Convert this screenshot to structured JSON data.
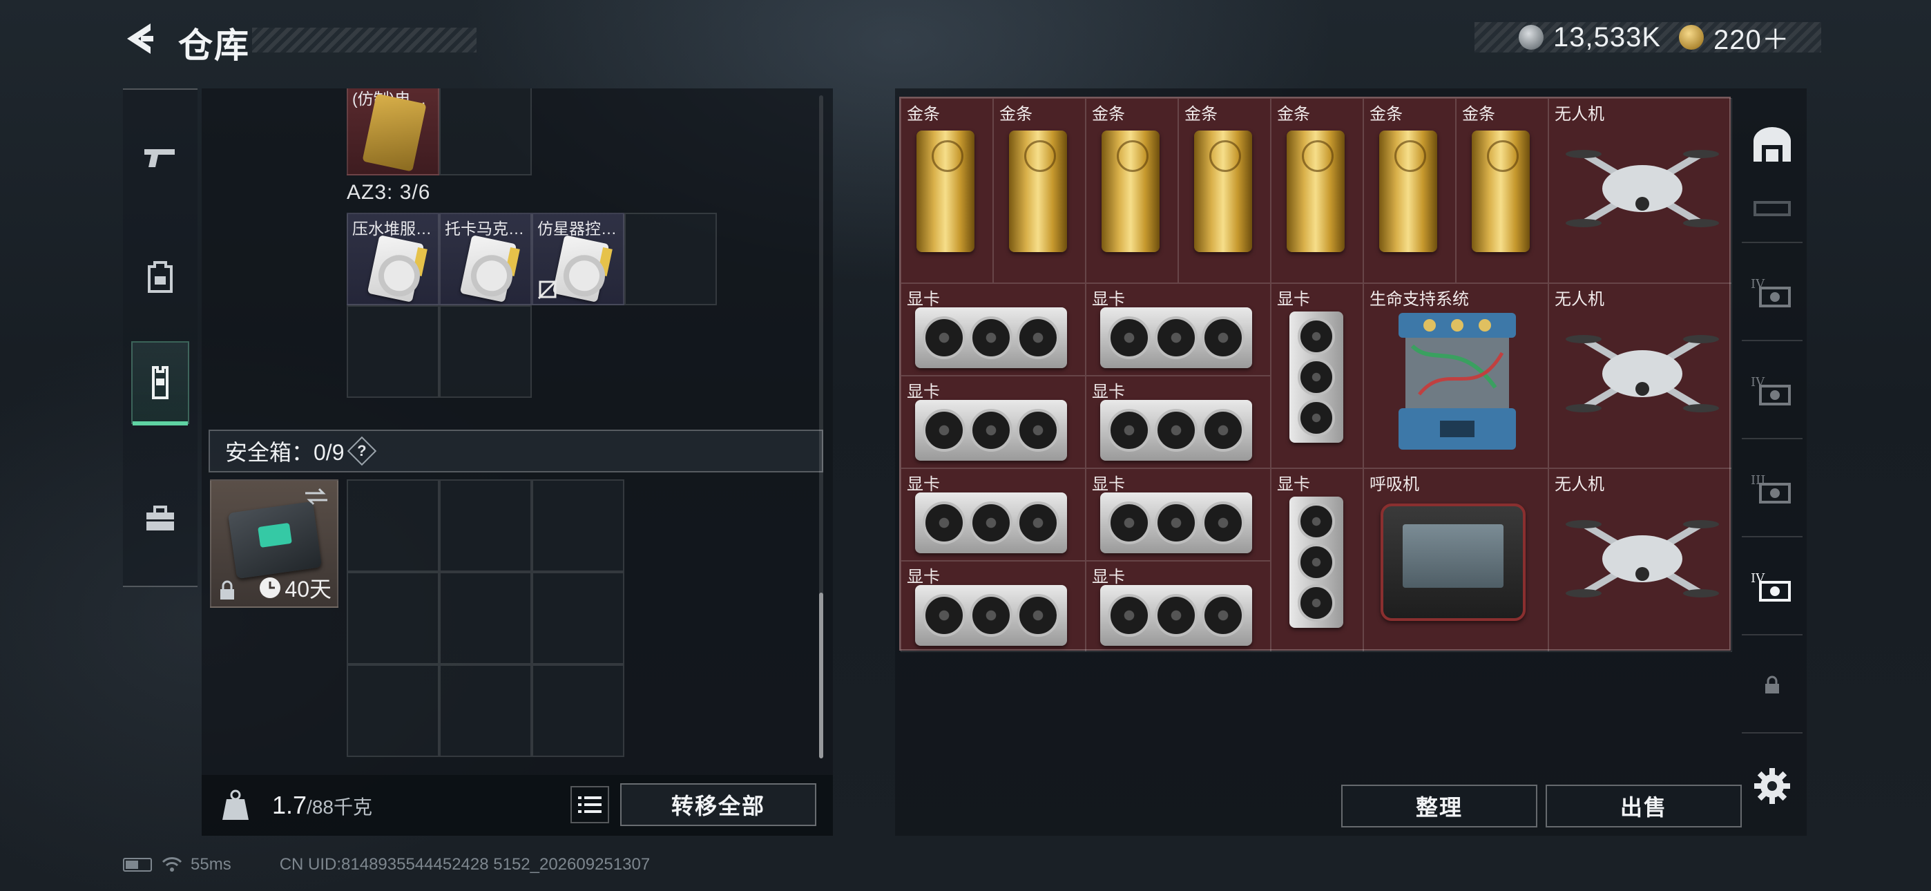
{
  "header": {
    "title": "仓库",
    "currency_silver": "13,533K",
    "currency_gold": "220＋"
  },
  "left_nav": {
    "items": [
      "weapon-icon",
      "backpack-icon",
      "vest-icon",
      "briefcase-icon"
    ],
    "active": "vest-icon"
  },
  "loadout": {
    "top_item_name": "(仿制)电…",
    "az3_label": "AZ3: 3/6",
    "az3_items": [
      "压水堆服…",
      "托卡马克…",
      "仿星器控…"
    ],
    "secure_label": "安全箱：0/9",
    "secure_help": "?",
    "case_duration": "40天",
    "weight_value": "1.7",
    "weight_unit": "/88千克",
    "transfer_all": "转移全部"
  },
  "stash": {
    "gold_label": "金条",
    "drone_label": "无人机",
    "gpu_label": "显卡",
    "life_support_label": "生命支持系统",
    "ventilator_label": "呼吸机",
    "cell_color": "#4b2226"
  },
  "actions": {
    "sort": "整理",
    "sell": "出售"
  },
  "status_bar": {
    "ping": "55ms",
    "uid": "CN UID:8148935544452428 5152_202609251307"
  }
}
